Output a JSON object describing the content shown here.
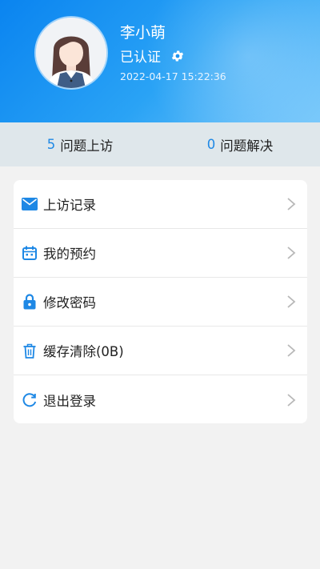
{
  "profile": {
    "name": "李小萌",
    "status": "已认证",
    "timestamp": "2022-04-17 15:22:36"
  },
  "stats": [
    {
      "count": "5",
      "label": "问题上访"
    },
    {
      "count": "0",
      "label": "问题解决"
    }
  ],
  "menu": [
    {
      "label": "上访记录",
      "icon": "mail-icon"
    },
    {
      "label": "我的预约",
      "icon": "calendar-icon"
    },
    {
      "label": "修改密码",
      "icon": "lock-icon"
    },
    {
      "label": "缓存清除(0B)",
      "icon": "trash-icon"
    },
    {
      "label": "退出登录",
      "icon": "refresh-icon"
    }
  ],
  "colors": {
    "accent": "#1e88e5",
    "header_start": "#0a84f0",
    "header_end": "#78c8fb"
  }
}
